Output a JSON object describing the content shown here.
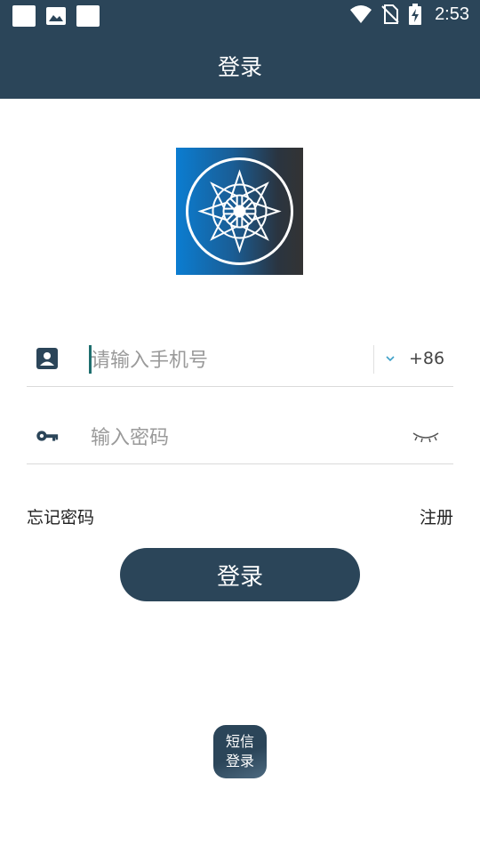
{
  "status_bar": {
    "time": "2:53",
    "left_icons": [
      "square-icon",
      "image-icon",
      "square-icon"
    ],
    "right_icons": [
      "wifi-icon",
      "no-sim-icon",
      "battery-charging-icon"
    ]
  },
  "app_bar": {
    "title": "登录"
  },
  "phone_field": {
    "placeholder": "请输入手机号",
    "country_code": "+86"
  },
  "password_field": {
    "placeholder": "输入密码"
  },
  "links": {
    "forgot": "忘记密码",
    "register": "注册"
  },
  "login_button": {
    "label": "登录"
  },
  "sms_login": {
    "line1": "短信",
    "line2": "登录"
  },
  "colors": {
    "primary": "#2b4559",
    "divider": "#dadada",
    "caret": "#1e6e6e"
  }
}
